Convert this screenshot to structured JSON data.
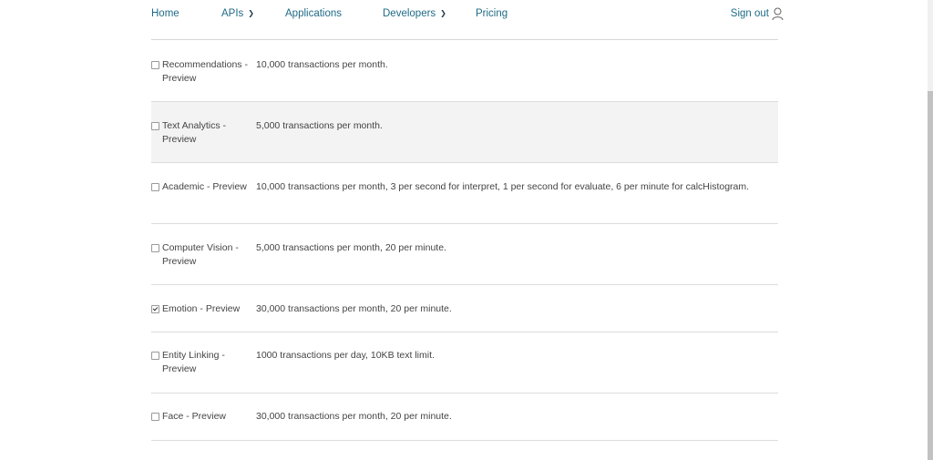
{
  "nav": {
    "home": "Home",
    "apis": "APIs",
    "applications": "Applications",
    "developers": "Developers",
    "pricing": "Pricing",
    "signout": "Sign out"
  },
  "colors": {
    "link": "#1f6b87",
    "row_shade": "#f3f3f3",
    "divider": "#dcdcdc"
  },
  "rows": [
    {
      "name": "Recommendations - Preview",
      "desc": "10,000 transactions per month.",
      "checked": false,
      "shaded": false
    },
    {
      "name": "Text Analytics - Preview",
      "desc": "5,000 transactions per month.",
      "checked": false,
      "shaded": true
    },
    {
      "name": "Academic - Preview",
      "desc": "10,000 transactions per month, 3 per second for interpret, 1 per second for evaluate, 6 per minute for calcHistogram.",
      "checked": false,
      "shaded": false
    },
    {
      "name": "Computer Vision - Preview",
      "desc": "5,000 transactions per month, 20 per minute.",
      "checked": false,
      "shaded": false
    },
    {
      "name": "Emotion - Preview",
      "desc": "30,000 transactions per month, 20 per minute.",
      "checked": true,
      "shaded": false
    },
    {
      "name": "Entity Linking - Preview",
      "desc": "1000 transactions per day, 10KB text limit.",
      "checked": false,
      "shaded": false
    },
    {
      "name": "Face - Preview",
      "desc": "30,000 transactions per month, 20 per minute.",
      "checked": false,
      "shaded": false
    }
  ]
}
